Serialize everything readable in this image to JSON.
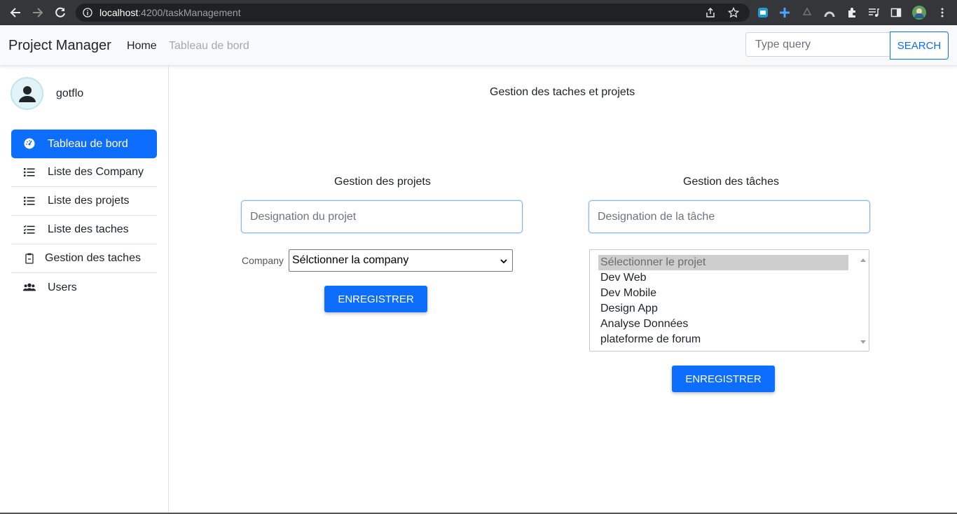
{
  "browser": {
    "url_host": "localhost",
    "url_path": ":4200/taskManagement"
  },
  "navbar": {
    "brand": "Project Manager",
    "home_label": "Home",
    "dashboard_label": "Tableau de bord",
    "search_placeholder": "Type query",
    "search_label": "SEARCH"
  },
  "sidebar": {
    "username": "gotflo",
    "items": [
      {
        "label": "Tableau de bord",
        "icon": "gauge-icon"
      },
      {
        "label": "Liste des Company",
        "icon": "list-icon"
      },
      {
        "label": "Liste des projets",
        "icon": "list-icon"
      },
      {
        "label": "Liste des taches",
        "icon": "list-check-icon"
      },
      {
        "label": "Gestion des taches",
        "icon": "clipboard-icon"
      },
      {
        "label": "Users",
        "icon": "users-icon"
      }
    ]
  },
  "main": {
    "page_title": "Gestion des taches et projets",
    "projects": {
      "title": "Gestion des projets",
      "designation_placeholder": "Designation du projet",
      "company_label": "Company",
      "company_selected": "Sélctionner la company",
      "save_label": "ENREGISTRER"
    },
    "tasks": {
      "title": "Gestion des tâches",
      "designation_placeholder": "Designation de la tâche",
      "project_options": [
        "Sélectionner le projet",
        "Dev Web",
        "Dev Mobile",
        "Design App",
        "Analyse Données",
        "plateforme de forum"
      ],
      "save_label": "ENREGISTRER"
    }
  },
  "colors": {
    "primary": "#0d6efd",
    "browser_bg": "#35363a"
  }
}
